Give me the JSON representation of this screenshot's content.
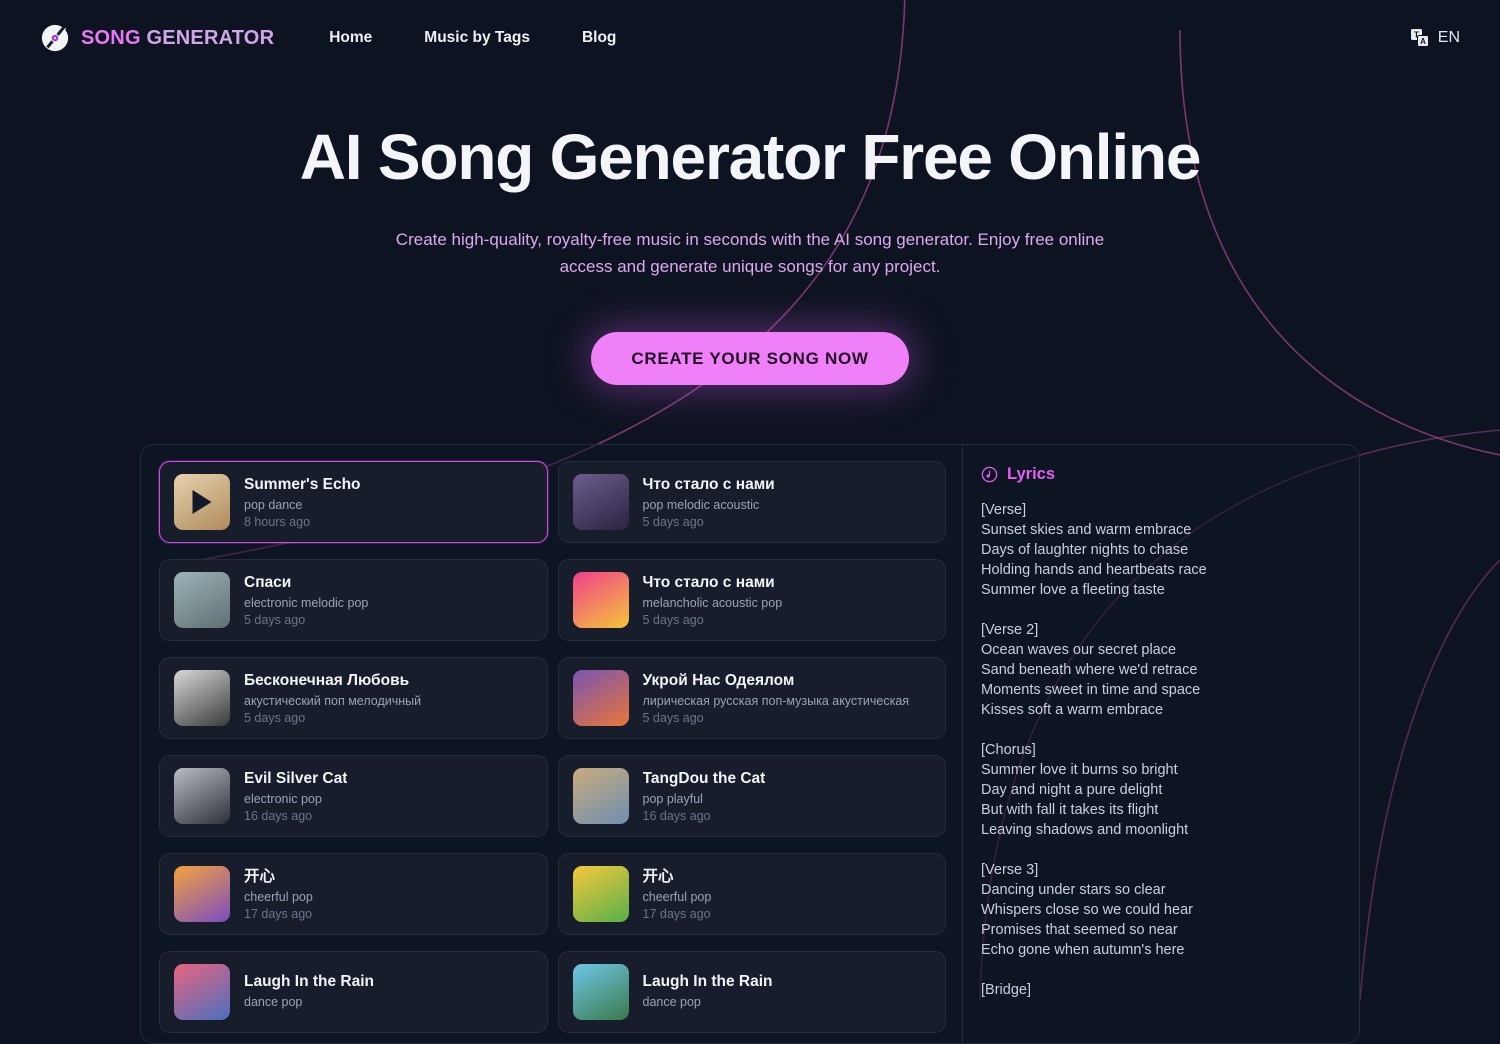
{
  "header": {
    "brand": {
      "primary": "SONG",
      "secondary": "GENERATOR",
      "icon": "vinyl-disc-icon"
    },
    "nav": [
      {
        "label": "Home"
      },
      {
        "label": "Music by Tags"
      },
      {
        "label": "Blog"
      }
    ],
    "language": {
      "label": "EN",
      "icon": "translate-icon"
    }
  },
  "hero": {
    "title": "AI Song Generator Free Online",
    "subtitle": "Create high-quality, royalty-free music in seconds with the AI song generator. Enjoy free online access and generate unique songs for any project.",
    "cta_label": "CREATE YOUR SONG NOW"
  },
  "songs": [
    {
      "title": "Summer's Echo",
      "tags": "pop dance",
      "time": "8 hours ago",
      "active": true,
      "c1": "#e6d3ae",
      "c2": "#b08a5c"
    },
    {
      "title": "Что стало с нами",
      "tags": "pop melodic acoustic",
      "time": "5 days ago",
      "active": false,
      "c1": "#6d5d8e",
      "c2": "#2a2340"
    },
    {
      "title": "Спаси",
      "tags": "electronic melodic pop",
      "time": "5 days ago",
      "active": false,
      "c1": "#9db4b8",
      "c2": "#5f6f72"
    },
    {
      "title": "Что стало с нами",
      "tags": "melancholic acoustic pop",
      "time": "5 days ago",
      "active": false,
      "c1": "#f0408a",
      "c2": "#f5c53a"
    },
    {
      "title": "Бесконечная Любовь",
      "tags": "акустический поп мелодичный",
      "time": "5 days ago",
      "active": false,
      "c1": "#d8d8d8",
      "c2": "#3a3a3a"
    },
    {
      "title": "Укрой Нас Одеялом",
      "tags": "лирическая русская поп-музыка акустическая",
      "time": "5 days ago",
      "active": false,
      "c1": "#7a54b0",
      "c2": "#e8763a"
    },
    {
      "title": "Evil Silver Cat",
      "tags": "electronic pop",
      "time": "16 days ago",
      "active": false,
      "c1": "#b9bcc2",
      "c2": "#2d3036"
    },
    {
      "title": "TangDou the Cat",
      "tags": "pop playful",
      "time": "16 days ago",
      "active": false,
      "c1": "#c9ab7e",
      "c2": "#6e8fb0"
    },
    {
      "title": "开心",
      "tags": "cheerful pop",
      "time": "17 days ago",
      "active": false,
      "c1": "#f5a33c",
      "c2": "#7a4cc0"
    },
    {
      "title": "开心",
      "tags": "cheerful pop",
      "time": "17 days ago",
      "active": false,
      "c1": "#f7c93c",
      "c2": "#56b04a"
    },
    {
      "title": "Laugh In the Rain",
      "tags": "dance pop",
      "time": "",
      "active": false,
      "c1": "#e8657f",
      "c2": "#4a6fc0"
    },
    {
      "title": "Laugh In the Rain",
      "tags": "dance pop",
      "time": "",
      "active": false,
      "c1": "#6fc6e8",
      "c2": "#3a7a4a"
    }
  ],
  "lyrics": {
    "heading": "Lyrics",
    "icon": "music-disc-icon",
    "text": "[Verse]\nSunset skies and warm embrace\nDays of laughter nights to chase\nHolding hands and heartbeats race\nSummer love a fleeting taste\n\n[Verse 2]\nOcean waves our secret place\nSand beneath where we'd retrace\nMoments sweet in time and space\nKisses soft a warm embrace\n\n[Chorus]\nSummer love it burns so bright\nDay and night a pure delight\nBut with fall it takes its flight\nLeaving shadows and moonlight\n\n[Verse 3]\nDancing under stars so clear\nWhispers close so we could hear\nPromises that seemed so near\nEcho gone when autumn's here\n\n[Bridge]"
  },
  "colors": {
    "background": "#0d1320",
    "accent": "#e779f7",
    "cta": "#ef80f7",
    "active_border": "#d24ae8",
    "card": "#171d2b",
    "arc": "#8e3f7e"
  }
}
